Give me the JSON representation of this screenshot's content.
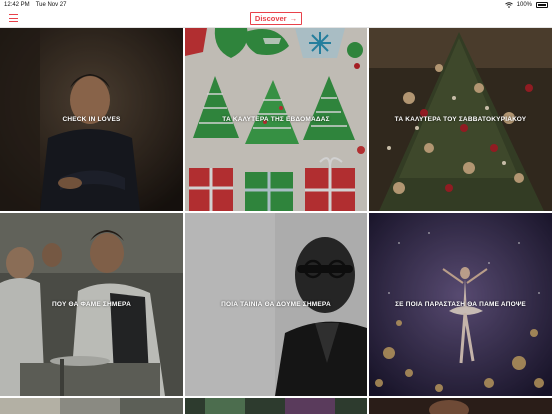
{
  "status_bar": {
    "time": "12:42 PM",
    "date": "Tue Nov 27",
    "battery": "100%"
  },
  "nav": {
    "discover_label": "Discover",
    "discover_arrow": "→",
    "menu_icon": "hamburger-menu-icon"
  },
  "colors": {
    "accent": "#e8414a",
    "nav_border": "#e4e4e4"
  },
  "tiles": [
    {
      "label": "CHECK IN LOVES"
    },
    {
      "label": "ΤΑ ΚΑΛΥΤΕΡΑ ΤΗΣ ΕΒΔΟΜΑΔΑΣ"
    },
    {
      "label": "ΤΑ ΚΑΛΥΤΕΡΑ ΤΟΥ ΣΑΒΒΑΤΟΚΥΡΙΑΚΟΥ"
    },
    {
      "label": "ΠΟΥ ΘΑ ΦΑΜΕ ΣΗΜΕΡΑ"
    },
    {
      "label": "ΠΟΙΑ ΤΑΙΝΙΑ ΘΑ ΔΟΥΜΕ ΣΗΜΕΡΑ"
    },
    {
      "label": "ΣΕ ΠΟΙΑ ΠΑΡΑΣΤΑΣΗ ΘΑ ΠΑΜΕ ΑΠΟΨΕ"
    }
  ]
}
